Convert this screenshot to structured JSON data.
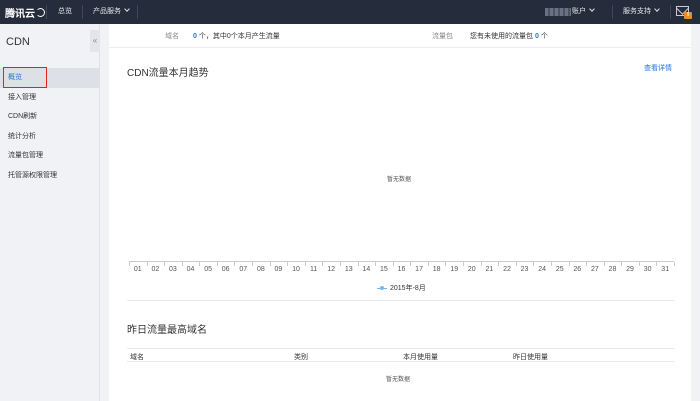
{
  "topbar": {
    "logo": "腾讯云",
    "nav_overview": "总览",
    "nav_products": "产品服务",
    "account": "账户",
    "support": "服务支持",
    "mail_badge": "9"
  },
  "sidebar": {
    "title": "CDN",
    "collapse_glyph": "«",
    "items": [
      {
        "label": "概览",
        "active": true
      },
      {
        "label": "接入管理"
      },
      {
        "label": "CDN刷新"
      },
      {
        "label": "统计分析"
      },
      {
        "label": "流量包管理"
      },
      {
        "label": "托管源权限管理"
      }
    ]
  },
  "summary": {
    "domain_label": "域名",
    "domain_count": "0",
    "domain_text": "个，其中0个本月产生流量",
    "package_label": "流量包",
    "package_text": "您有未使用的流量包",
    "package_count": "0",
    "package_unit": "个"
  },
  "trend": {
    "title": "CDN流量本月趋势",
    "more": "查看详情",
    "empty": "暂无数据"
  },
  "chart_data": {
    "type": "line",
    "title": "CDN流量本月趋势",
    "categories": [
      "01",
      "02",
      "03",
      "04",
      "05",
      "06",
      "07",
      "08",
      "09",
      "10",
      "11",
      "12",
      "13",
      "14",
      "15",
      "16",
      "17",
      "18",
      "19",
      "20",
      "21",
      "22",
      "23",
      "24",
      "25",
      "26",
      "27",
      "28",
      "29",
      "30",
      "31"
    ],
    "series": [
      {
        "name": "2015年-8月",
        "values": []
      }
    ],
    "legend_position": "bottom-center",
    "series_color": "#7cb5ec",
    "empty_text": "暂无数据"
  },
  "top_domains": {
    "title": "昨日流量最高域名",
    "columns": [
      "域名",
      "类别",
      "本月使用量",
      "昨日使用量"
    ],
    "empty": "暂无数据"
  },
  "colors": {
    "topbar_bg": "#252c3c",
    "accent": "#2277da",
    "highlight_box": "#e2231a",
    "badge": "#f08a24"
  }
}
